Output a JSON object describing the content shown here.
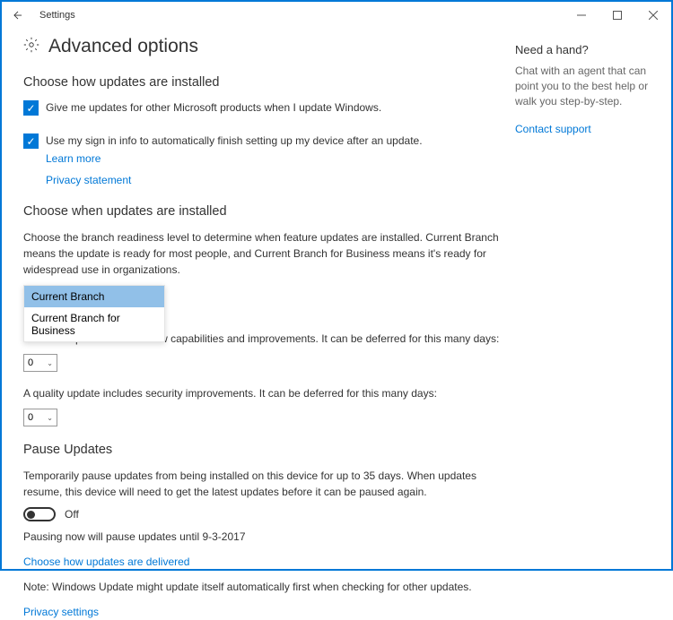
{
  "window": {
    "title": "Settings"
  },
  "page": {
    "title": "Advanced options"
  },
  "section_how": {
    "title": "Choose how updates are installed",
    "cb1_label": "Give me updates for other Microsoft products when I update Windows.",
    "cb2_label": "Use my sign in info to automatically finish setting up my device after an update.",
    "learn_more": "Learn more",
    "privacy_statement": "Privacy statement"
  },
  "section_when": {
    "title": "Choose when updates are installed",
    "desc": "Choose the branch readiness level to determine when feature updates are installed. Current Branch means the update is ready for most people, and Current Branch for Business means it's ready for widespread use in organizations.",
    "branch_options": {
      "opt1": "Current Branch",
      "opt2": "Current Branch for Business"
    },
    "feature_desc": "A feature update includes new capabilities and improvements. It can be deferred for this many days:",
    "feature_val": "0",
    "quality_desc": "A quality update includes security improvements. It can be deferred for this many days:",
    "quality_val": "0"
  },
  "section_pause": {
    "title": "Pause Updates",
    "desc": "Temporarily pause updates from being installed on this device for up to 35 days. When updates resume, this device will need to get the latest updates before it can be paused again.",
    "toggle_state": "Off",
    "pause_note": "Pausing now will pause updates until 9-3-2017"
  },
  "footer": {
    "delivery_link": "Choose how updates are delivered",
    "note": "Note: Windows Update might update itself automatically first when checking for other updates.",
    "privacy_link": "Privacy settings"
  },
  "help": {
    "title": "Need a hand?",
    "text": "Chat with an agent that can point you to the best help or walk you step-by-step.",
    "contact": "Contact support"
  }
}
